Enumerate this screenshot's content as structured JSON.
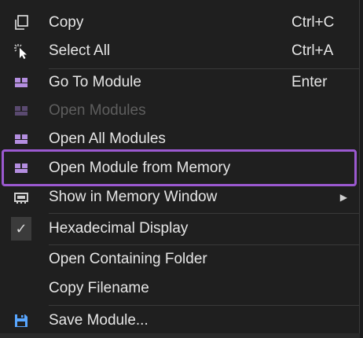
{
  "menu": {
    "items": [
      {
        "icon": "copy-icon",
        "label": "Copy",
        "shortcut": "Ctrl+C"
      },
      {
        "icon": "select-all-icon",
        "label": "Select All",
        "shortcut": "Ctrl+A"
      },
      {
        "icon": "module-icon",
        "label": "Go To Module",
        "shortcut": "Enter"
      },
      {
        "icon": "module-icon",
        "label": "Open Modules",
        "shortcut": "",
        "disabled": true
      },
      {
        "icon": "module-icon",
        "label": "Open All Modules",
        "shortcut": ""
      },
      {
        "icon": "module-icon",
        "label": "Open Module from Memory",
        "shortcut": "",
        "highlighted": true
      },
      {
        "icon": "memory-window-icon",
        "label": "Show in Memory Window",
        "shortcut": "",
        "submenu": true
      },
      {
        "icon": "checkmark-icon",
        "label": "Hexadecimal Display",
        "shortcut": "",
        "checked": true
      },
      {
        "icon": "",
        "label": "Open Containing Folder",
        "shortcut": ""
      },
      {
        "icon": "",
        "label": "Copy Filename",
        "shortcut": ""
      },
      {
        "icon": "save-icon",
        "label": "Save Module...",
        "shortcut": ""
      }
    ],
    "checkmark": "✓",
    "submenu_arrow": "▶"
  },
  "colors": {
    "background": "#1f1f1f",
    "text": "#e6e6e6",
    "disabled_text": "#5e5e5e",
    "module_icon": "#b48ee0",
    "save_icon": "#58a6ff",
    "highlight_border": "#9b59d0"
  }
}
